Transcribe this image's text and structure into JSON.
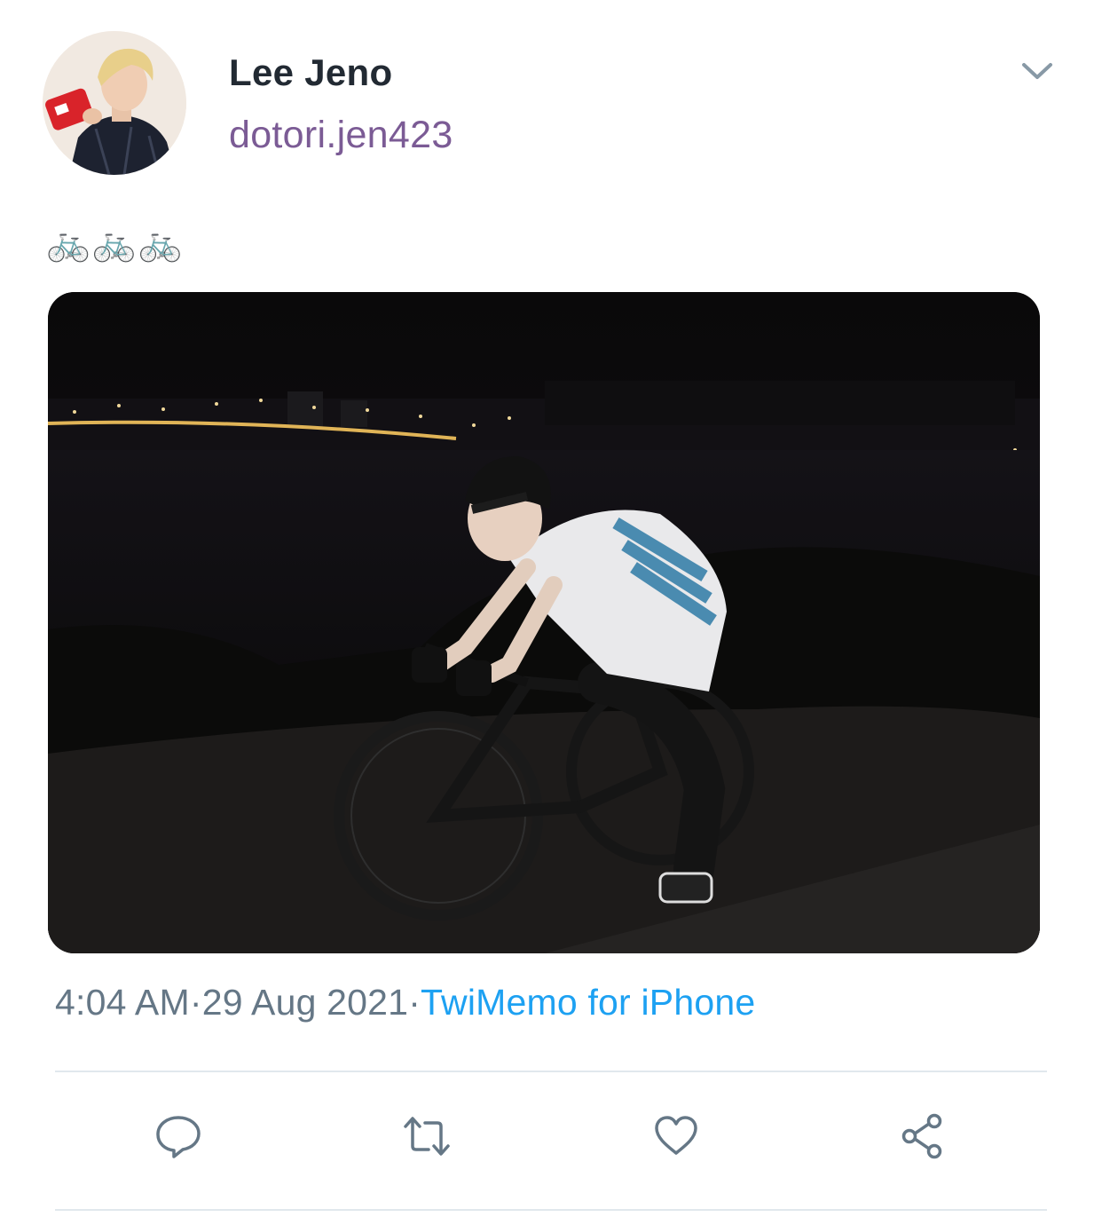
{
  "author": {
    "display_name": "Lee Jeno",
    "handle": "dotori.jen423",
    "avatar_icon": "profile-photo"
  },
  "tweet": {
    "text_emojis": [
      "🚲",
      "🚲",
      "🚲"
    ],
    "media_description_icon": "photo-night-cyclist",
    "time": "4:04 AM",
    "separator": "·",
    "date": "29 Aug 2021",
    "source": "TwiMemo for iPhone"
  },
  "actions": {
    "reply_icon": "reply-icon",
    "retweet_icon": "retweet-icon",
    "like_icon": "heart-icon",
    "share_icon": "share-icon"
  },
  "colors": {
    "name": "#222a33",
    "handle": "#7b5b95",
    "meta": "#657786",
    "link": "#1da1f2",
    "icon": "#657786",
    "divider": "#e1e8ed"
  }
}
